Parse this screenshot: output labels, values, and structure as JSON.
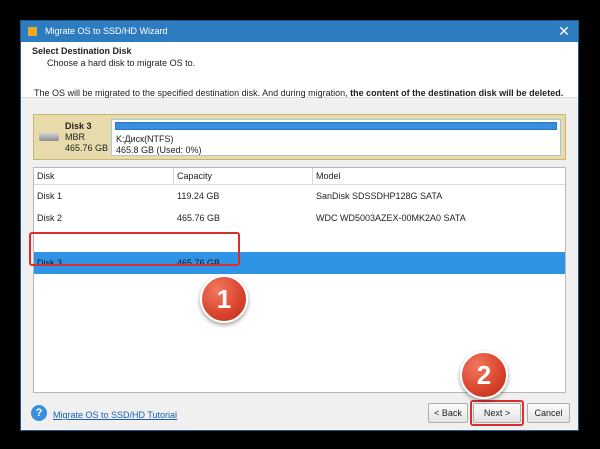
{
  "window": {
    "title": "Migrate OS to SSD/HD Wizard",
    "close_glyph": "✕"
  },
  "header": {
    "title": "Select Destination Disk",
    "subtitle": "Choose a hard disk to migrate OS to."
  },
  "notice": {
    "text_plain": "The OS will be migrated to the specified destination disk. And during migration, ",
    "text_bold": "the content of the destination disk will be deleted."
  },
  "selected_disk": {
    "name": "Disk 3",
    "type": "MBR",
    "size": "465.76 GB",
    "partition_label": "K:Диск(NTFS)",
    "partition_usage": "465.8 GB (Used: 0%)",
    "used_fraction": 1.0,
    "icon": "hard-disk-icon"
  },
  "table": {
    "columns": [
      "Disk",
      "Capacity",
      "Model"
    ],
    "rows": [
      {
        "disk": "Disk 1",
        "capacity": "119.24 GB",
        "model": "SanDisk SDSSDHP128G SATA"
      },
      {
        "disk": "Disk 2",
        "capacity": "465.76 GB",
        "model": "WDC WD5003AZEX-00MK2A0 SATA"
      },
      {
        "disk": "Disk 3",
        "capacity": "465.76 GB",
        "model": ""
      }
    ],
    "selected_index": 2
  },
  "annotations": {
    "step1": "1",
    "step2": "2"
  },
  "footer": {
    "tutorial_link": "Migrate OS to SSD/HD Tutorial",
    "help_icon_glyph": "?",
    "back_label": "< Back",
    "next_label": "Next >",
    "cancel_label": "Cancel"
  },
  "colors": {
    "titlebar": "#2e7cc0",
    "selection": "#2f93e6",
    "annotation": "#d92e2e"
  }
}
